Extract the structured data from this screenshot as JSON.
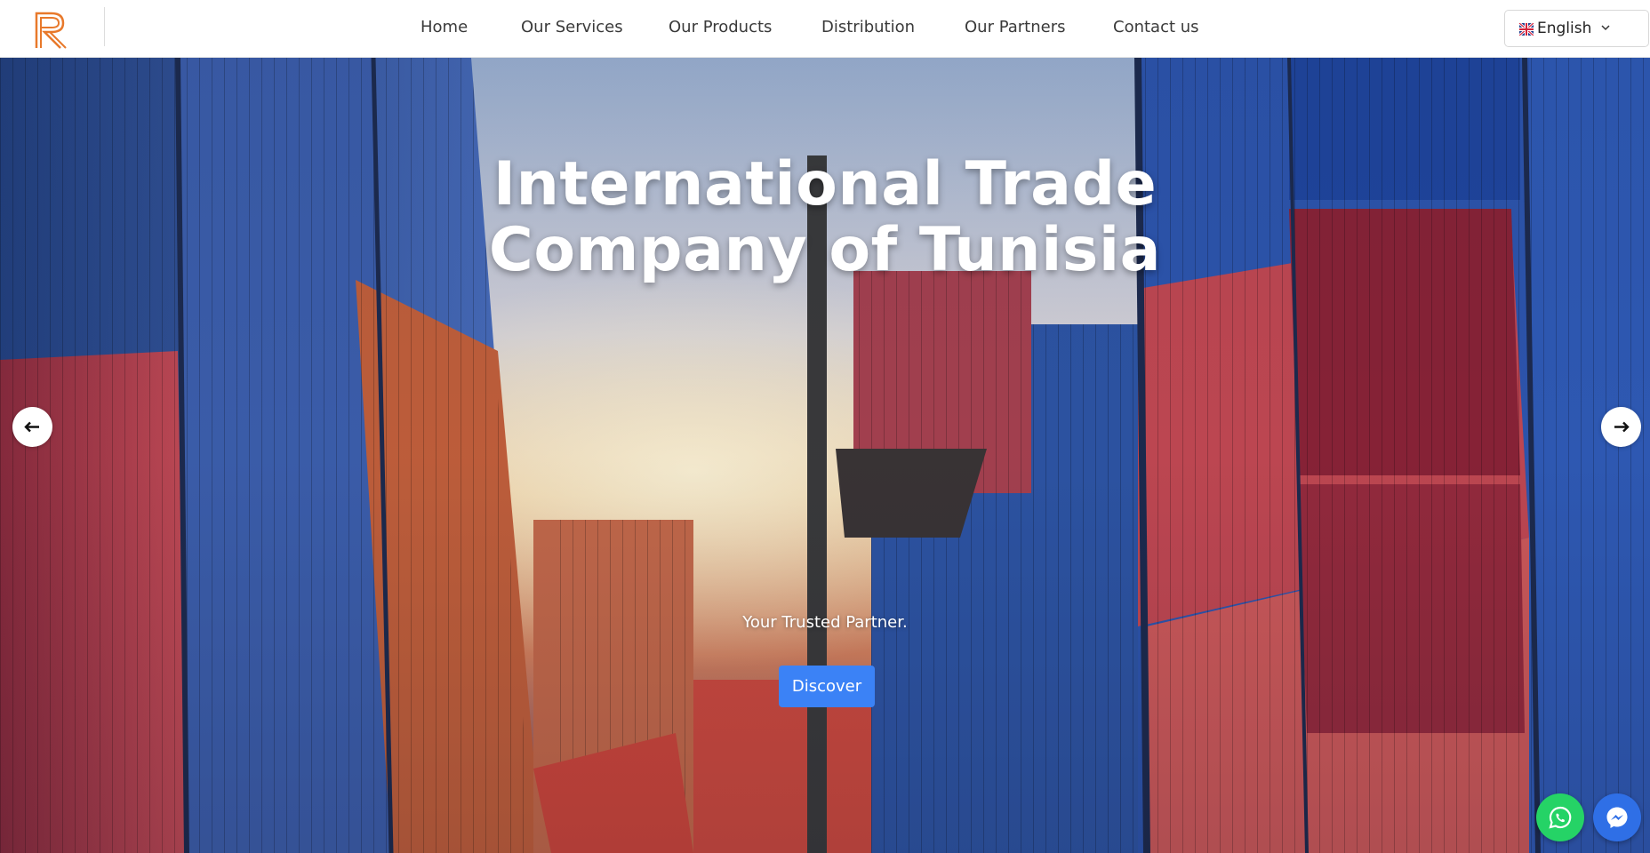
{
  "header": {
    "logo_alt": "R",
    "nav": [
      {
        "label": "Home"
      },
      {
        "label": "Our Services"
      },
      {
        "label": "Our Products"
      },
      {
        "label": "Distribution"
      },
      {
        "label": "Our Partners"
      },
      {
        "label": "Contact us"
      }
    ],
    "language": {
      "selected": "English",
      "flag": "uk-flag-icon"
    }
  },
  "hero": {
    "title_line1": "International Trade",
    "title_line2": "Company of Tunisia",
    "subtitle": "Your Trusted Partner.",
    "cta_label": "Discover",
    "prev_icon": "arrow-left-icon",
    "next_icon": "arrow-right-icon"
  },
  "floating": {
    "whatsapp_icon": "whatsapp-icon",
    "messenger_icon": "messenger-icon"
  },
  "colors": {
    "logo_orange": "#e8792b",
    "cta_blue": "#3b82f6",
    "whatsapp_green": "#25d366",
    "messenger_blue": "#2f6fe6"
  }
}
